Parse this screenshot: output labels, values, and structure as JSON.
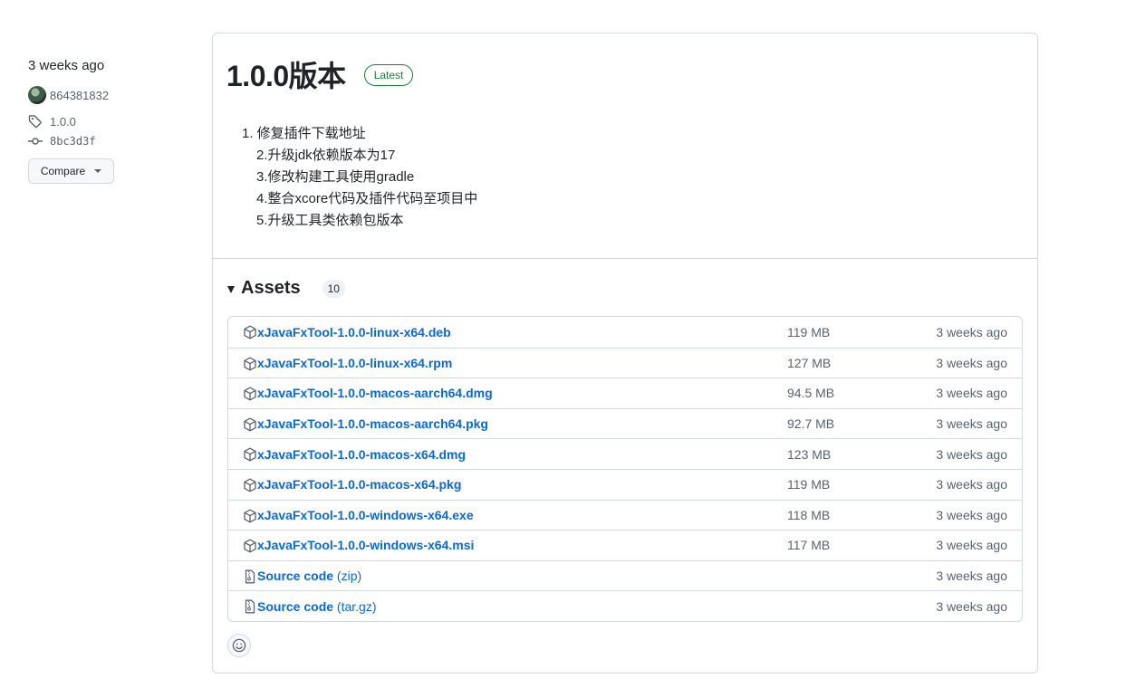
{
  "meta": {
    "released_ago": "3 weeks ago",
    "author": "864381832",
    "tag": "1.0.0",
    "commit": "8bc3d3f",
    "compare_label": "Compare"
  },
  "release": {
    "title": "1.0.0版本",
    "latest_label": "Latest",
    "notes": [
      "1. 修复插件下载地址",
      "2.升级jdk依赖版本为17",
      "3.修改构建工具使用gradle",
      "4.整合xcore代码及插件代码至项目中",
      "5.升级工具类依赖包版本"
    ]
  },
  "assets": {
    "title": "Assets",
    "count": "10",
    "items": [
      {
        "name": "xJavaFxTool-1.0.0-linux-x64.deb",
        "size": "119 MB",
        "time": "3 weeks ago",
        "icon": "package-icon"
      },
      {
        "name": "xJavaFxTool-1.0.0-linux-x64.rpm",
        "size": "127 MB",
        "time": "3 weeks ago",
        "icon": "package-icon"
      },
      {
        "name": "xJavaFxTool-1.0.0-macos-aarch64.dmg",
        "size": "94.5 MB",
        "time": "3 weeks ago",
        "icon": "package-icon"
      },
      {
        "name": "xJavaFxTool-1.0.0-macos-aarch64.pkg",
        "size": "92.7 MB",
        "time": "3 weeks ago",
        "icon": "package-icon"
      },
      {
        "name": "xJavaFxTool-1.0.0-macos-x64.dmg",
        "size": "123 MB",
        "time": "3 weeks ago",
        "icon": "package-icon"
      },
      {
        "name": "xJavaFxTool-1.0.0-macos-x64.pkg",
        "size": "119 MB",
        "time": "3 weeks ago",
        "icon": "package-icon"
      },
      {
        "name": "xJavaFxTool-1.0.0-windows-x64.exe",
        "size": "118 MB",
        "time": "3 weeks ago",
        "icon": "package-icon"
      },
      {
        "name": "xJavaFxTool-1.0.0-windows-x64.msi",
        "size": "117 MB",
        "time": "3 weeks ago",
        "icon": "package-icon"
      }
    ],
    "source": [
      {
        "name": "Source code",
        "format": "(zip)",
        "time": "3 weeks ago",
        "icon": "file-zip-icon"
      },
      {
        "name": "Source code",
        "format": "(tar.gz)",
        "time": "3 weeks ago",
        "icon": "file-zip-icon"
      }
    ]
  },
  "colors": {
    "link": "#0969da",
    "latest_green": "#1a7f37",
    "muted": "#59636e",
    "border": "#d1d9e0"
  }
}
